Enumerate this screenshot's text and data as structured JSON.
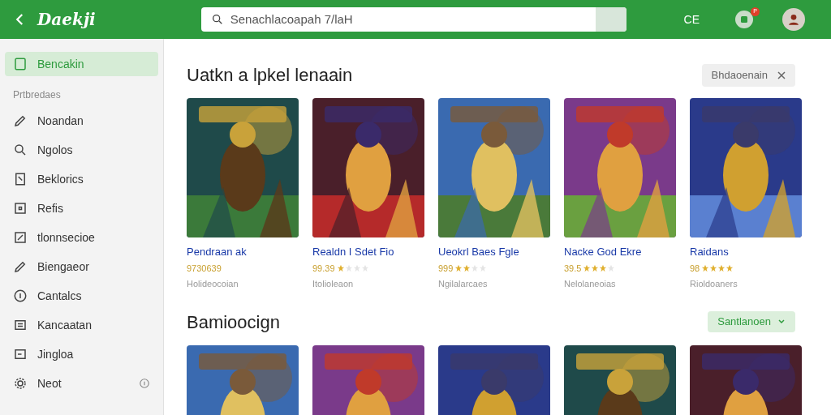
{
  "top_bar": {
    "logo": "Daekji",
    "search": {
      "value": "Senachlacoapah 7/laH"
    },
    "short_label": "CE",
    "notification_badge": "P"
  },
  "sidebar": {
    "items": [
      {
        "label": "Bencakin",
        "selected": true
      },
      {
        "label": "Prtbredaes",
        "kind": "heading"
      },
      {
        "label": "Noandan",
        "selected": false
      },
      {
        "label": "Ngolos",
        "selected": false
      },
      {
        "label": "Beklorics",
        "selected": false
      },
      {
        "label": "Refis",
        "selected": false
      },
      {
        "label": "tlonnsecioe",
        "selected": false
      },
      {
        "label": "Biengaeor",
        "selected": false
      },
      {
        "label": "Cantalcs",
        "selected": false
      },
      {
        "label": "Kancaatan",
        "selected": false
      },
      {
        "label": "Jingloa",
        "selected": false
      },
      {
        "label": "Neot",
        "selected": false,
        "info": true
      }
    ]
  },
  "sections": [
    {
      "title": "Uatkn a lpkel lenaain",
      "action": {
        "label": "Bhdaoenain",
        "kind": "close"
      },
      "cards": [
        {
          "title": "Pendraan ak",
          "rating": "9730639",
          "subtitle": "Holideocoian"
        },
        {
          "title": "Realdn I Sdet Fio",
          "rating": "99.39",
          "stars": 1,
          "subtitle": "Itolioleaon"
        },
        {
          "title": "Ueokrl Baes Fgle",
          "rating": "999",
          "stars": 2,
          "subtitle": "Ngilalarcaes"
        },
        {
          "title": "Nacke God Ekre",
          "rating": "39.5",
          "stars": 3,
          "subtitle": "Nelolaneoias"
        },
        {
          "title": "Raidans",
          "rating": "98",
          "stars": 4,
          "subtitle": "Rioldoaners"
        }
      ]
    },
    {
      "title": "Bamioocign",
      "action": {
        "label": "Santlanoen",
        "kind": "dropdown"
      }
    }
  ]
}
